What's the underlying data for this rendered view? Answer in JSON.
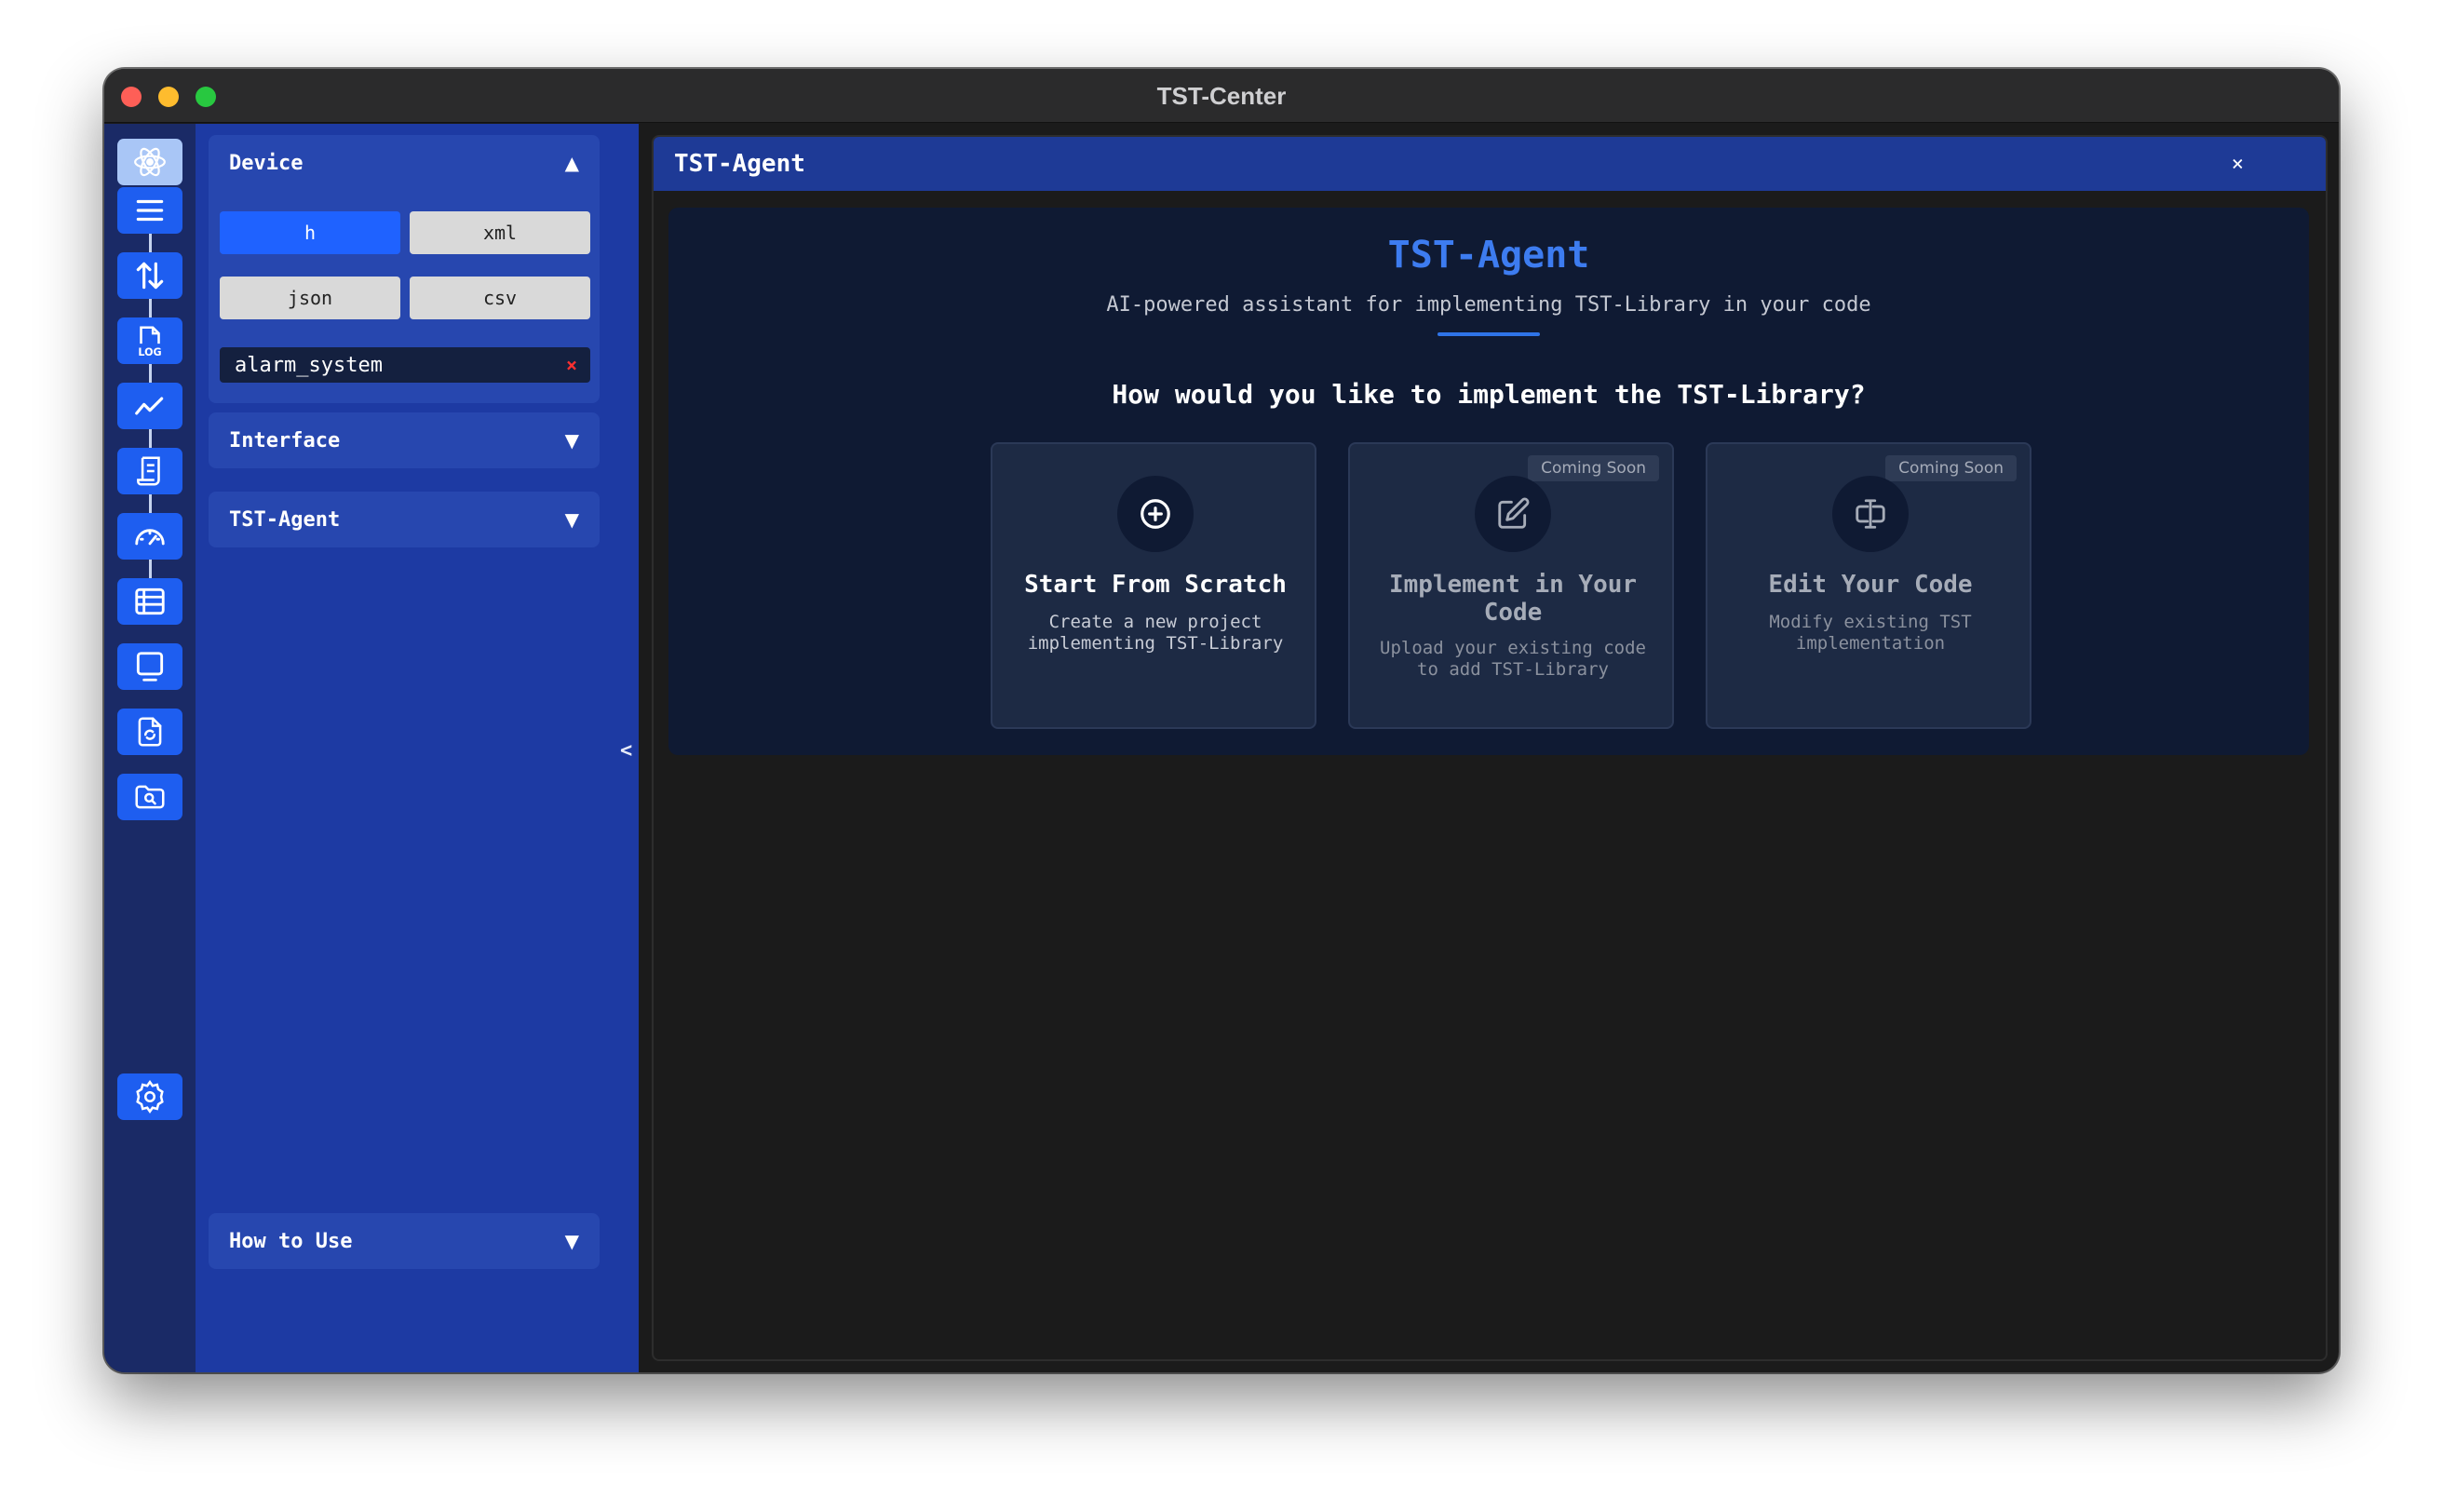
{
  "window": {
    "title": "TST-Center"
  },
  "sidebar": {
    "device": {
      "title": "Device",
      "arrow": "▲",
      "formats": [
        "h",
        "xml",
        "json",
        "csv"
      ],
      "active_format": "h",
      "file": {
        "name": "alarm_system",
        "remove": "×"
      }
    },
    "interface": {
      "title": "Interface",
      "arrow": "▼"
    },
    "agent": {
      "title": "TST-Agent",
      "arrow": "▼"
    },
    "how_to_use": {
      "title": "How to Use",
      "arrow": "▼"
    },
    "collapse": "<"
  },
  "main": {
    "header": {
      "title": "TST-Agent",
      "close": "×"
    },
    "agent": {
      "title": "TST-Agent",
      "subtitle": "AI-powered assistant for implementing TST-Library in your code",
      "question": "How would you like to implement the TST-Library?",
      "cards": [
        {
          "title": "Start From Scratch",
          "desc": "Create a new project implementing TST-Library",
          "badge": ""
        },
        {
          "title": "Implement in Your Code",
          "desc": "Upload your existing code to add TST-Library",
          "badge": "Coming Soon"
        },
        {
          "title": "Edit Your Code",
          "desc": "Modify existing TST implementation",
          "badge": "Coming Soon"
        }
      ]
    }
  },
  "rail_icons": [
    "atom-icon",
    "menu-icon",
    "transfer-icon",
    "log-icon",
    "chart-icon",
    "script-icon",
    "gauge-icon",
    "table-icon",
    "monitor-icon",
    "file-sync-icon",
    "folder-search-icon",
    "settings-icon"
  ],
  "colors": {
    "accent": "#1f62ff",
    "panel": "#1d3aa3",
    "header": "#1e3a96",
    "agent_title": "#3d7cf0"
  }
}
